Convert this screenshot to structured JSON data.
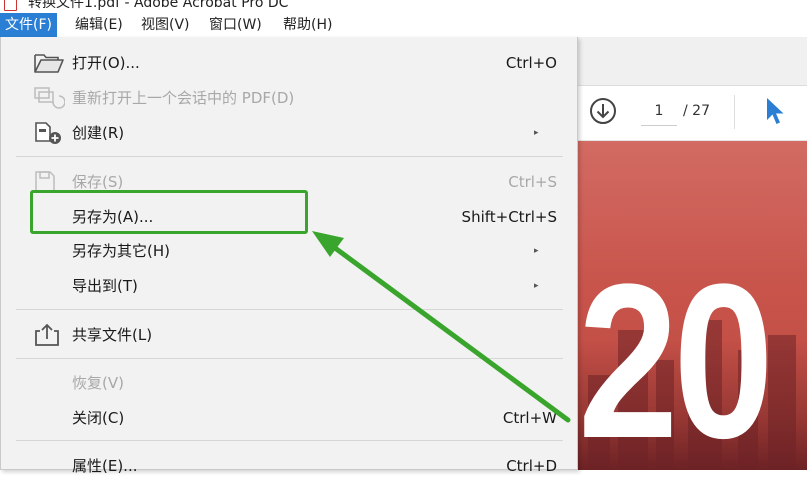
{
  "window": {
    "title": "转换文件1.pdf - Adobe Acrobat Pro DC"
  },
  "menubar": [
    {
      "label": "文件(F)",
      "active": true
    },
    {
      "label": "编辑(E)"
    },
    {
      "label": "视图(V)"
    },
    {
      "label": "窗口(W)"
    },
    {
      "label": "帮助(H)"
    }
  ],
  "file_menu": {
    "items": [
      {
        "label": "打开(O)...",
        "shortcut": "Ctrl+O",
        "icon": "folder-open-icon",
        "enabled": true
      },
      {
        "label": "重新打开上一个会话中的 PDF(D)",
        "shortcut": "",
        "icon": "reopen-session-icon",
        "enabled": false
      },
      {
        "label": "创建(R)",
        "shortcut": "",
        "icon": "create-pdf-icon",
        "enabled": true,
        "submenu": true
      },
      {
        "label": "保存(S)",
        "shortcut": "Ctrl+S",
        "icon": "save-icon",
        "enabled": false
      },
      {
        "label": "另存为(A)...",
        "shortcut": "Shift+Ctrl+S",
        "enabled": true,
        "highlighted": true
      },
      {
        "label": "另存为其它(H)",
        "shortcut": "",
        "enabled": true,
        "submenu": true
      },
      {
        "label": "导出到(T)",
        "shortcut": "",
        "enabled": true,
        "submenu": true
      },
      {
        "label": "共享文件(L)",
        "shortcut": "",
        "icon": "share-icon",
        "enabled": true
      },
      {
        "label": "恢复(V)",
        "shortcut": "",
        "enabled": false
      },
      {
        "label": "关闭(C)",
        "shortcut": "Ctrl+W",
        "enabled": true
      },
      {
        "label": "属性(E)...",
        "shortcut": "Ctrl+D",
        "enabled": true
      }
    ],
    "submenu_arrow": "▸"
  },
  "toolbar": {
    "current_page": "1",
    "page_total": "/ 27",
    "icons": [
      "download-circle-icon",
      "select-cursor-icon"
    ]
  },
  "document_preview": {
    "big_text": "20"
  },
  "colors": {
    "menu_active": "#2a7fd4",
    "highlight": "#3aa52c",
    "preview_red": "#c8544b"
  }
}
